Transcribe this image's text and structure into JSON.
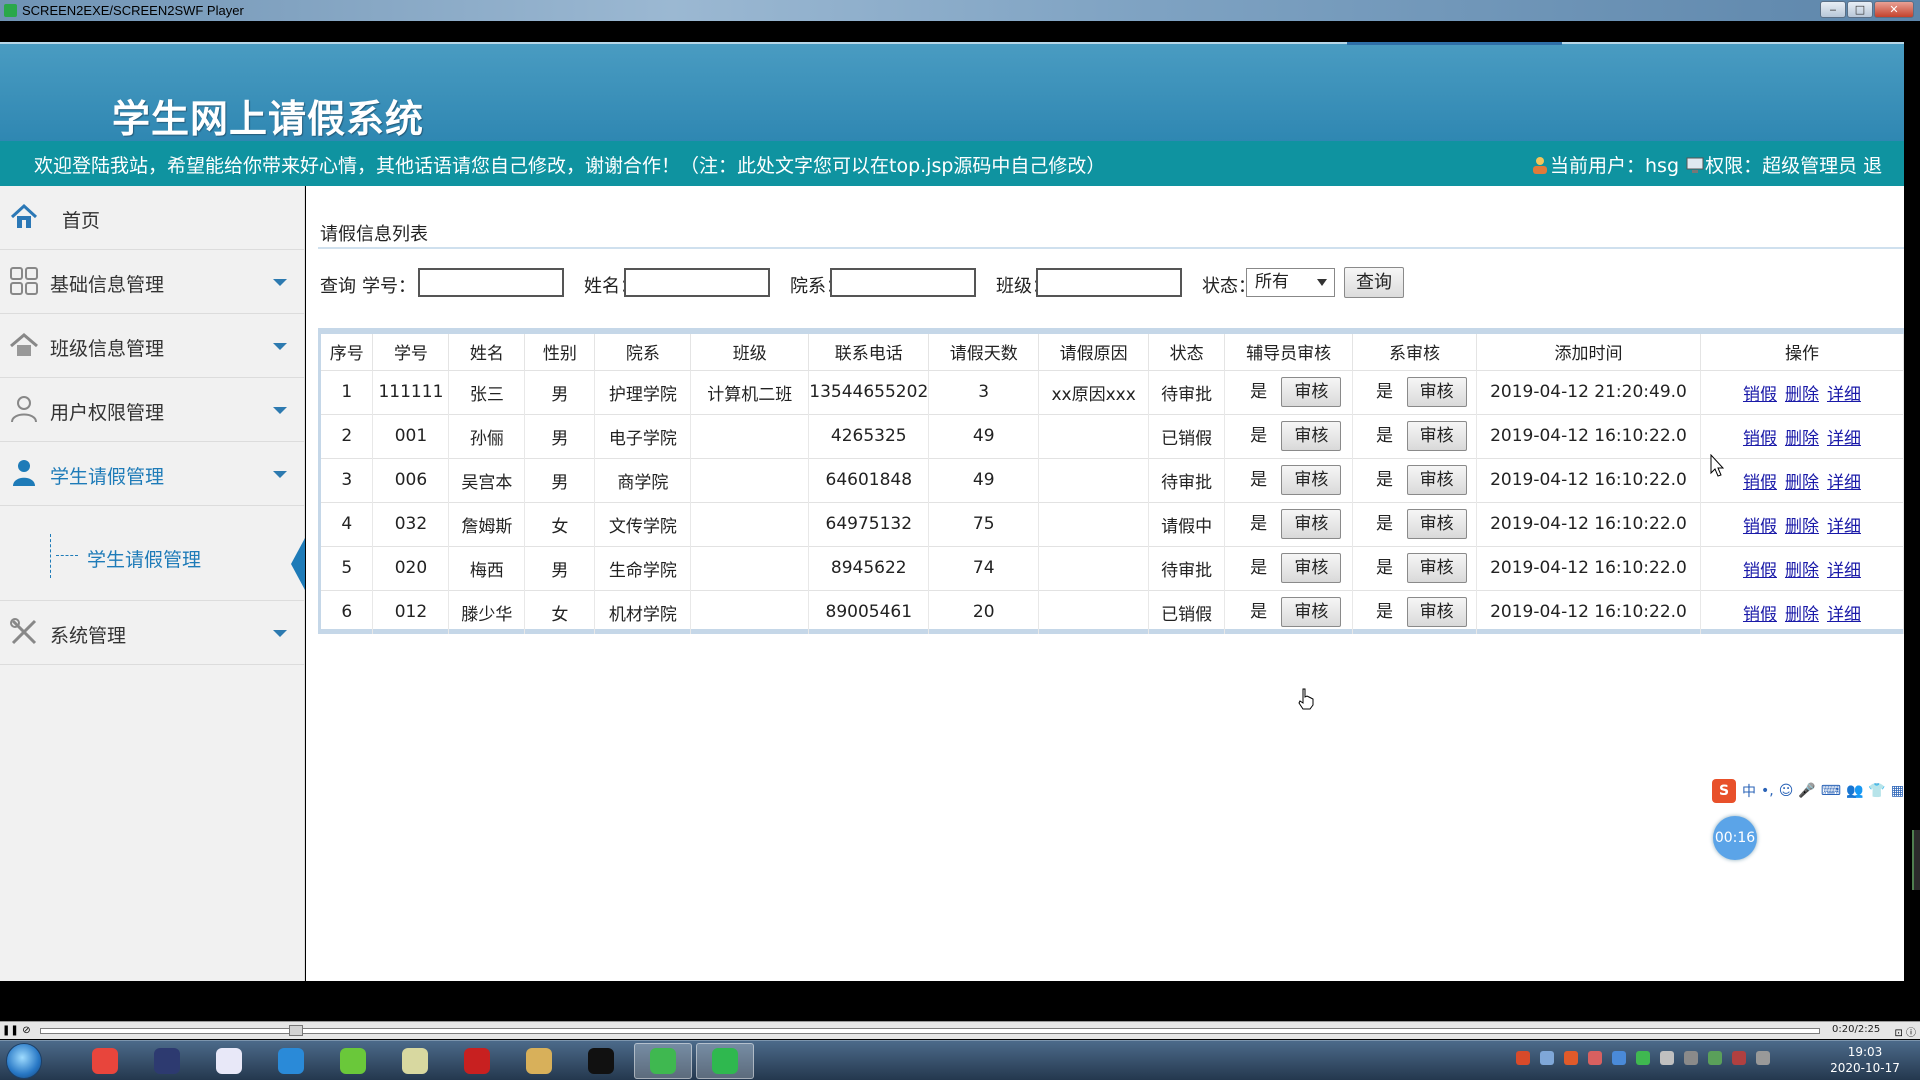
{
  "window": {
    "title": "SCREEN2EXE/SCREEN2SWF Player",
    "min_label": "‒",
    "max_label": "□",
    "close_label": "✕"
  },
  "header": {
    "site_title": "学生网上请假系统",
    "welcome_message": "欢迎登陆我站，希望能给你带来好心情，其他话语请您自己修改，谢谢合作！（注：此处文字您可以在top.jsp源码中自己修改）",
    "current_user_text": "当前用户：hsg",
    "role_text": "权限：超级管理员",
    "logout_text": "退"
  },
  "sidebar": {
    "items": [
      {
        "label": "首页",
        "icon": "home-icon"
      },
      {
        "label": "基础信息管理",
        "icon": "grid-icon"
      },
      {
        "label": "班级信息管理",
        "icon": "house-icon"
      },
      {
        "label": "用户权限管理",
        "icon": "user-icon"
      },
      {
        "label": "学生请假管理",
        "icon": "student-icon"
      },
      {
        "label": "系统管理",
        "icon": "tools-icon"
      }
    ],
    "sub_item": "学生请假管理"
  },
  "main": {
    "panel_title": "请假信息列表",
    "search": {
      "query_label": "查询",
      "student_id_label": "学号：",
      "name_label": "姓名：",
      "dept_label": "院系：",
      "class_label": "班级：",
      "status_label": "状态：",
      "status_value": "所有",
      "button_label": "查询"
    },
    "table": {
      "columns": [
        "序号",
        "学号",
        "姓名",
        "性别",
        "院系",
        "班级",
        "联系电话",
        "请假天数",
        "请假原因",
        "状态",
        "辅导员审核",
        "系审核",
        "添加时间",
        "操作"
      ],
      "audit_yes": "是",
      "audit_button": "审核",
      "op_links": [
        "销假",
        "删除",
        "详细"
      ],
      "rows": [
        {
          "no": "1",
          "sid": "111111",
          "name": "张三",
          "gender": "男",
          "dept": "护理学院",
          "cls": "计算机二班",
          "phone": "13544655202",
          "days": "3",
          "reason": "xx原因xxx",
          "status": "待审批",
          "time": "2019-04-12 21:20:49.0"
        },
        {
          "no": "2",
          "sid": "001",
          "name": "孙俪",
          "gender": "男",
          "dept": "电子学院",
          "cls": "",
          "phone": "4265325",
          "days": "49",
          "reason": "",
          "status": "已销假",
          "time": "2019-04-12 16:10:22.0"
        },
        {
          "no": "3",
          "sid": "006",
          "name": "吴宫本",
          "gender": "男",
          "dept": "商学院",
          "cls": "",
          "phone": "64601848",
          "days": "49",
          "reason": "",
          "status": "待审批",
          "time": "2019-04-12 16:10:22.0"
        },
        {
          "no": "4",
          "sid": "032",
          "name": "詹姆斯",
          "gender": "女",
          "dept": "文传学院",
          "cls": "",
          "phone": "64975132",
          "days": "75",
          "reason": "",
          "status": "请假中",
          "time": "2019-04-12 16:10:22.0"
        },
        {
          "no": "5",
          "sid": "020",
          "name": "梅西",
          "gender": "男",
          "dept": "生命学院",
          "cls": "",
          "phone": "8945622",
          "days": "74",
          "reason": "",
          "status": "待审批",
          "time": "2019-04-12 16:10:22.0"
        },
        {
          "no": "6",
          "sid": "012",
          "name": "滕少华",
          "gender": "女",
          "dept": "机材学院",
          "cls": "",
          "phone": "89005461",
          "days": "20",
          "reason": "",
          "status": "已销假",
          "time": "2019-04-12 16:10:22.0"
        }
      ]
    }
  },
  "overlay": {
    "ime_logo": "S",
    "ime_mode": "中",
    "recording_timer": "00:16"
  },
  "player": {
    "time_display": "0:20/2:25",
    "progress": 0.14
  },
  "taskbar": {
    "apps": [
      "chrome-icon",
      "editor-icon",
      "paint-icon",
      "browser-icon",
      "leaf-icon",
      "notepad-icon",
      "flash-icon",
      "folder-icon",
      "qq-icon",
      "wechat-icon",
      "player-icon"
    ],
    "clock_time": "19:03",
    "clock_date": "2020-10-17"
  },
  "colors": {
    "banner": "#3a92bd",
    "welcome_bar": "#0f93a0",
    "accent": "#1e7bb8",
    "link": "#1a1aa8"
  }
}
